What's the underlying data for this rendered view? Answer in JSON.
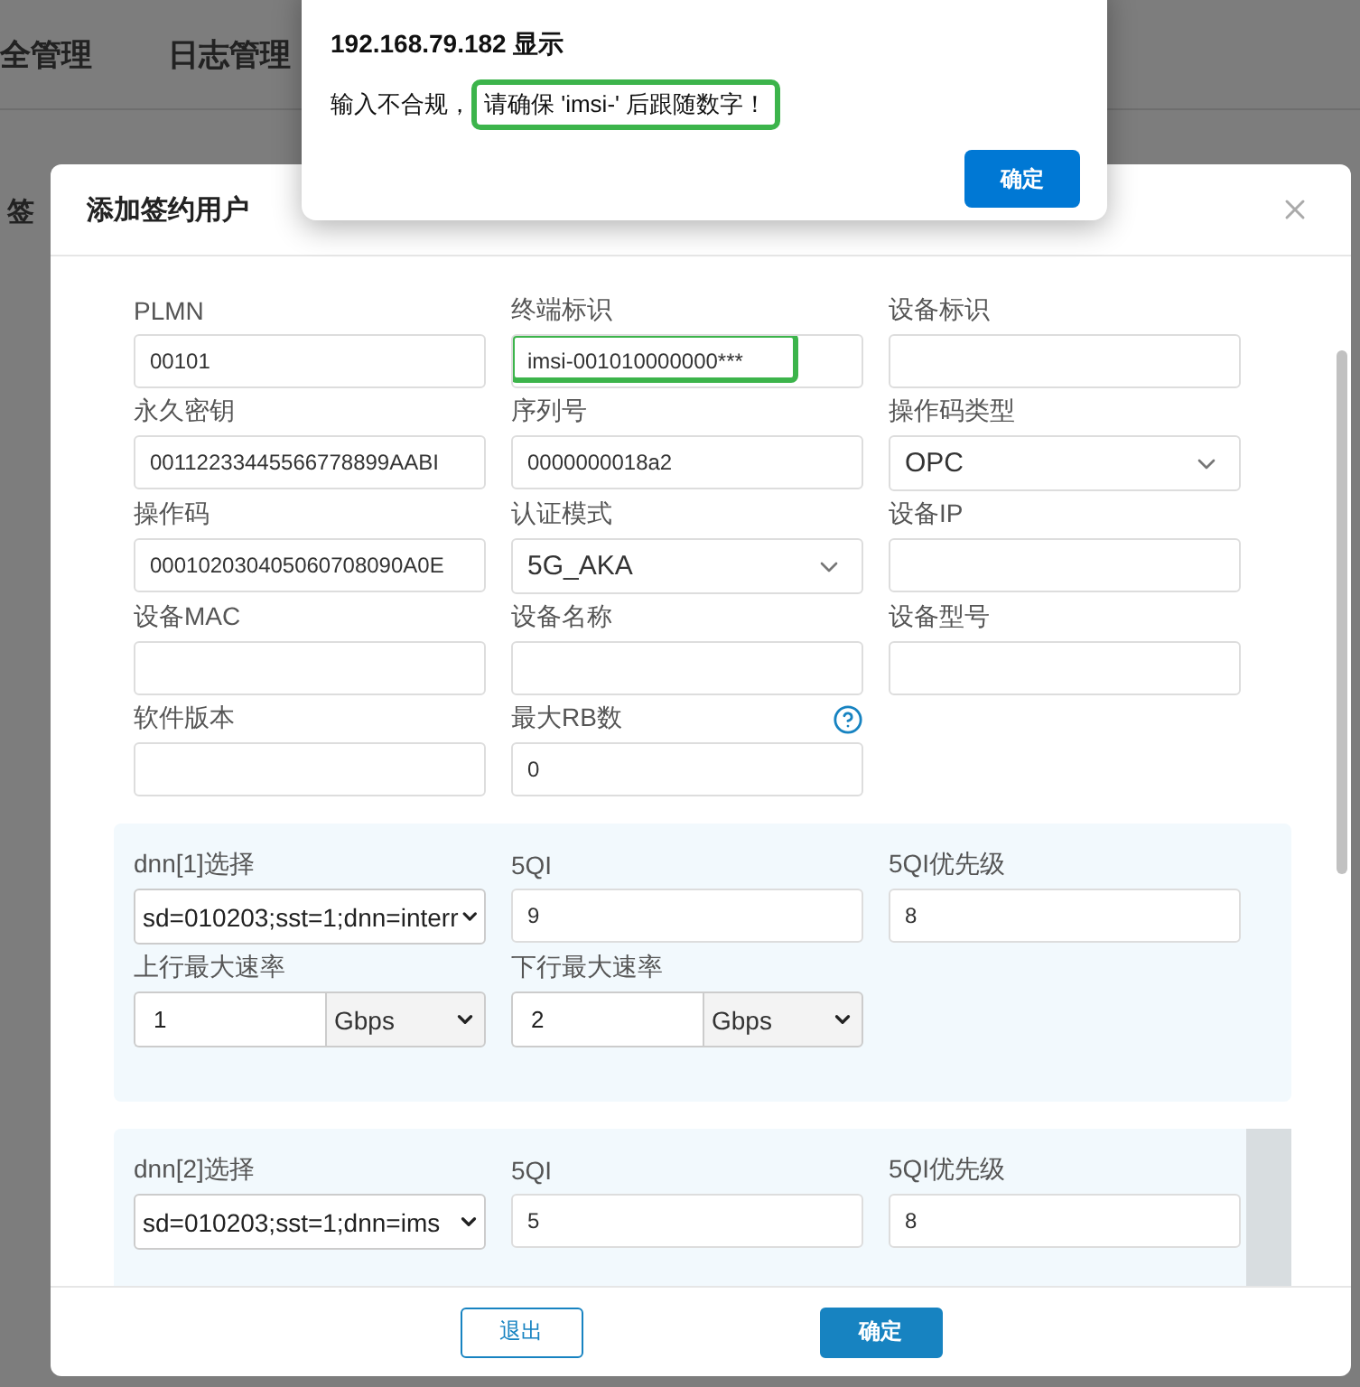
{
  "background": {
    "nav_items": [
      "全管理",
      "日志管理"
    ],
    "side_label": "签"
  },
  "alert": {
    "title": "192.168.79.182 显示",
    "message": "输入不合规，",
    "message_highlighted": "请确保 'imsi-' 后跟随数字！",
    "button": "确定"
  },
  "dialog": {
    "title": "添加签约用户",
    "fields": [
      {
        "kind": "input",
        "label": "PLMN",
        "value": "00101"
      },
      {
        "kind": "input",
        "label": "终端标识",
        "value": "imsi-001010000000***",
        "highlighted": true
      },
      {
        "kind": "input",
        "label": "设备标识"
      },
      {
        "kind": "input",
        "label": "永久密钥",
        "value": "00112233445566778899AABI"
      },
      {
        "kind": "input",
        "label": "序列号",
        "value": "0000000018a2"
      },
      {
        "kind": "select",
        "label": "操作码类型",
        "value": "OPC"
      },
      {
        "kind": "input",
        "label": "操作码",
        "value": "000102030405060708090A0E"
      },
      {
        "kind": "select",
        "label": "认证模式",
        "value": "5G_AKA"
      },
      {
        "kind": "input",
        "label": "设备IP"
      },
      {
        "kind": "input",
        "label": "设备MAC"
      },
      {
        "kind": "input",
        "label": "设备名称"
      },
      {
        "kind": "input",
        "label": "设备型号"
      },
      {
        "kind": "input",
        "label": "软件版本"
      },
      {
        "kind": "input",
        "label": "最大RB数",
        "value": "0",
        "help": true
      }
    ],
    "dnn_groups": [
      {
        "fields": [
          {
            "kind": "native_select",
            "label": "dnn[1]选择",
            "value": "sd=010203;sst=1;dnn=interr"
          },
          {
            "kind": "input",
            "label": "5QI",
            "value": "9"
          },
          {
            "kind": "input",
            "label": "5QI优先级",
            "value": "8"
          },
          {
            "kind": "rate",
            "label": "上行最大速率",
            "value": "1",
            "unit": "Gbps"
          },
          {
            "kind": "rate",
            "label": "下行最大速率",
            "value": "2",
            "unit": "Gbps"
          }
        ]
      },
      {
        "fields": [
          {
            "kind": "native_select",
            "label": "dnn[2]选择",
            "value": "sd=010203;sst=1;dnn=ims"
          },
          {
            "kind": "input",
            "label": "5QI",
            "value": "5"
          },
          {
            "kind": "input",
            "label": "5QI优先级",
            "value": "8"
          }
        ]
      }
    ],
    "buttons": [
      {
        "label": "退出",
        "kind": "secondary"
      },
      {
        "label": "确定",
        "kind": "primary"
      }
    ]
  }
}
